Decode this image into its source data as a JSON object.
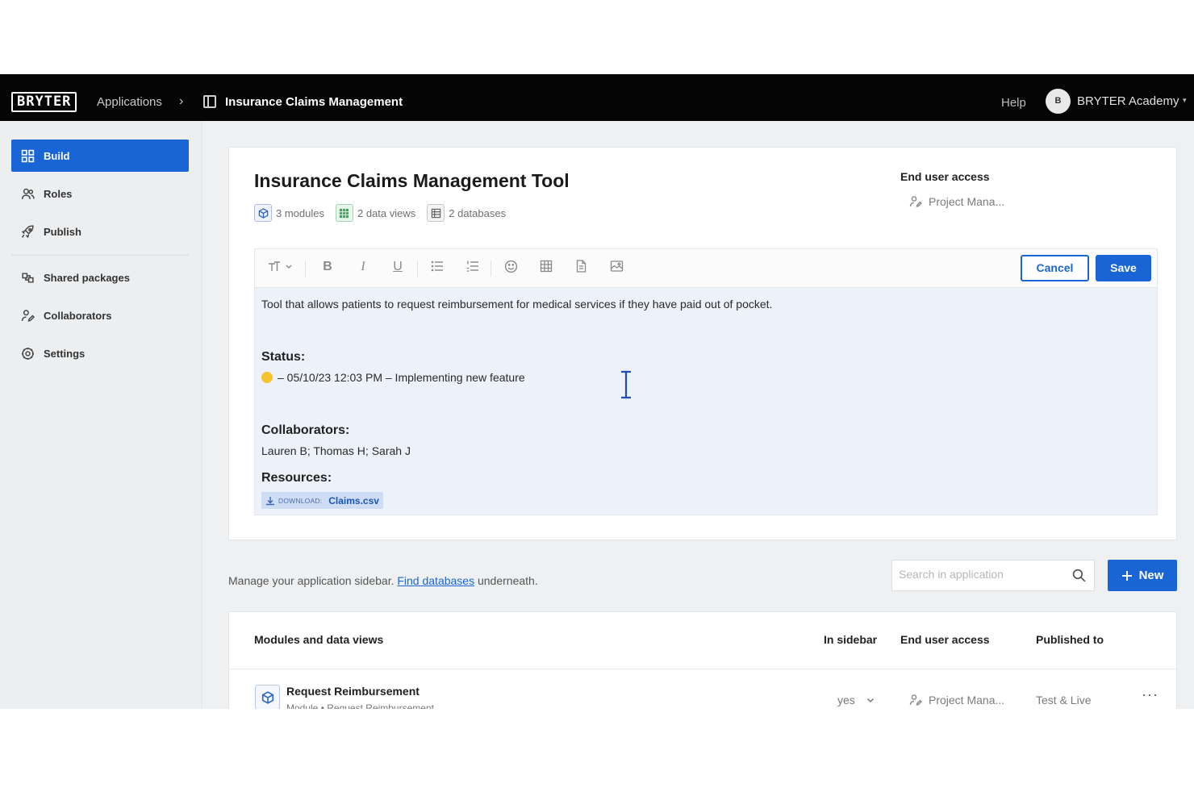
{
  "topbar": {
    "logo": "BRYTER",
    "breadcrumb_apps": "Applications",
    "breadcrumb_sep": "›",
    "breadcrumb_app": "Insurance Claims Management",
    "help": "Help",
    "avatar_initial": "B",
    "account_name": "BRYTER Academy",
    "account_caret": "▾"
  },
  "sidebar": {
    "items": [
      {
        "label": "Build",
        "icon": "grid-icon",
        "active": true
      },
      {
        "label": "Roles",
        "icon": "users-icon"
      },
      {
        "label": "Publish",
        "icon": "rocket-icon"
      },
      {
        "label": "Shared packages",
        "icon": "package-icon"
      },
      {
        "label": "Collaborators",
        "icon": "user-edit-icon"
      },
      {
        "label": "Settings",
        "icon": "gear-icon"
      }
    ]
  },
  "app": {
    "title": "Insurance Claims Management Tool",
    "modules": "3 modules",
    "data_views": "2 data views",
    "databases": "2 databases",
    "end_user_access_label": "End user access",
    "end_user_access_value": "Project Mana..."
  },
  "editor": {
    "cancel_label": "Cancel",
    "save_label": "Save",
    "description": "Tool that allows patients to request reimbursement for medical services if they have paid out of pocket.",
    "status_heading": "Status:",
    "status_text": "– 05/10/23 12:03 PM – Implementing new feature",
    "collaborators_heading": "Collaborators:",
    "collaborators_text": "Lauren B; Thomas H; Sarah J",
    "resources_heading": "Resources:",
    "download_prefix": "DOWNLOAD:",
    "download_file": "Claims.csv"
  },
  "manager": {
    "text_before": "Manage your application sidebar.",
    "link": "Find databases",
    "text_after": "underneath.",
    "search_placeholder": "Search in application",
    "new_label": "New"
  },
  "table": {
    "headers": {
      "modules": "Modules and data views",
      "in_sidebar": "In sidebar",
      "end_user_access": "End user access",
      "published_to": "Published to"
    },
    "rows": [
      {
        "title": "Request Reimbursement",
        "subtitle": "Module • Request Reimbursement",
        "in_sidebar": "yes",
        "end_user_access": "Project Mana...",
        "published_to": "Test & Live",
        "more": "···"
      }
    ]
  },
  "colors": {
    "accent": "#1a65d6",
    "topbar": "#050505",
    "status_yellow": "#f4c430"
  }
}
